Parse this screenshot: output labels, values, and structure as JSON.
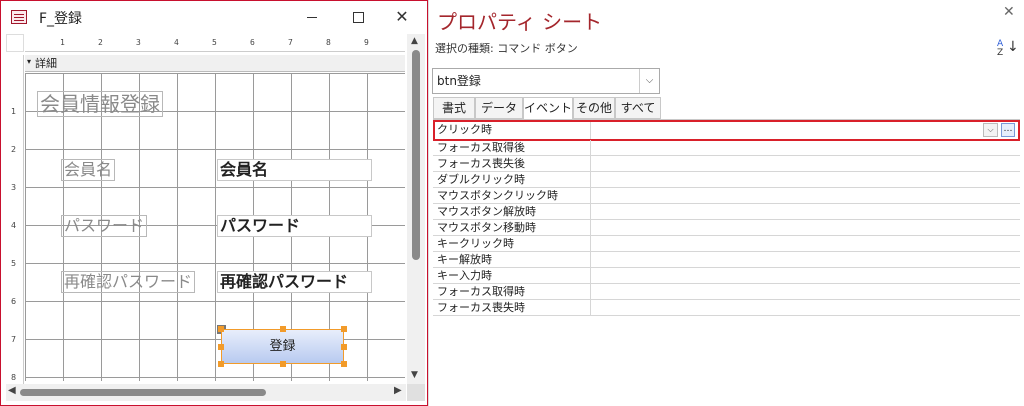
{
  "form_window": {
    "title": "F_登録",
    "section": "詳細",
    "h_ruler_marks": [
      "1",
      "2",
      "3",
      "4",
      "5",
      "6",
      "7",
      "8",
      "9"
    ],
    "v_ruler_marks": [
      "1",
      "2",
      "3",
      "4",
      "5",
      "6",
      "7",
      "8"
    ],
    "controls": {
      "title_label": "会員情報登録",
      "name_label": "会員名",
      "name_field": "会員名",
      "password_label": "パスワード",
      "password_field": "パスワード",
      "confirm_password_label": "再確認パスワード",
      "confirm_password_field": "再確認パスワード",
      "register_button": "登録"
    }
  },
  "property_sheet": {
    "title": "プロパティ シート",
    "selection_type": "選択の種類: コマンド ボタン",
    "selected_object": "btn登録",
    "tabs": [
      "書式",
      "データ",
      "イベント",
      "その他",
      "すべて"
    ],
    "active_tab": "イベント",
    "properties": [
      "クリック時",
      "フォーカス取得後",
      "フォーカス喪失後",
      "ダブルクリック時",
      "マウスボタンクリック時",
      "マウスボタン解放時",
      "マウスボタン移動時",
      "キークリック時",
      "キー解放時",
      "キー入力時",
      "フォーカス取得時",
      "フォーカス喪失時"
    ],
    "highlight_color": "#d9202a"
  },
  "colors": {
    "accent": "#a4262c",
    "selection_handle": "#f29b2a"
  }
}
